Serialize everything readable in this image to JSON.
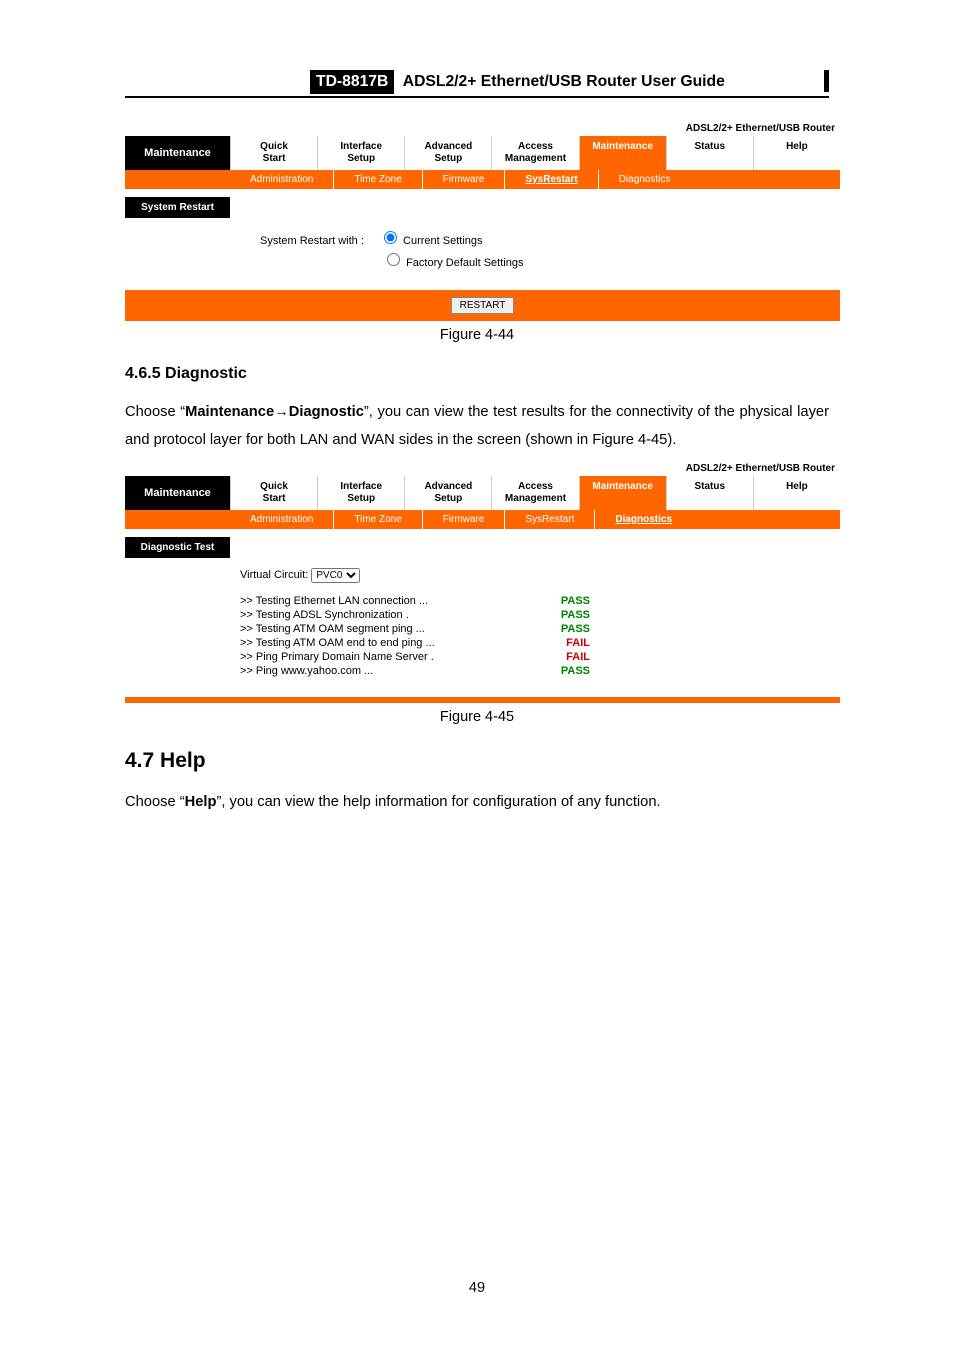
{
  "header": {
    "model": "TD-8817B",
    "title": "ADSL2/2+ Ethernet/USB Router User Guide"
  },
  "brand": "ADSL2/2+ Ethernet/USB Router",
  "top_tabs": [
    "Quick\nStart",
    "Interface\nSetup",
    "Advanced\nSetup",
    "Access\nManagement",
    "Maintenance",
    "Status",
    "Help"
  ],
  "sub_tabs_1": [
    "Administration",
    "Time Zone",
    "Firmware",
    "SysRestart",
    "Diagnostics"
  ],
  "maintenance_label": "Maintenance",
  "panel1": {
    "section": "System Restart",
    "active_sub": "SysRestart",
    "restart_label": "System Restart with :",
    "opts": [
      "Current Settings",
      "Factory Default Settings"
    ],
    "button": "RESTART",
    "caption": "Figure 4-44"
  },
  "sec465": {
    "num": "4.6.5  Diagnostic",
    "para1a": "Choose “",
    "bold1": "Maintenance→Diagnostic",
    "para1b": "”, you can view the test results for the connectivity of the physical layer and protocol layer for both LAN and WAN sides in the screen (shown in Figure 4-45)."
  },
  "panel2": {
    "section": "Diagnostic Test",
    "active_sub": "Diagnostics",
    "vc_label": "Virtual Circuit:",
    "vc_value": "PVC0",
    "rows": [
      {
        "t": ">> Testing Ethernet LAN connection ...",
        "s": "PASS"
      },
      {
        "t": ">> Testing ADSL Synchronization .",
        "s": "PASS"
      },
      {
        "t": ">> Testing ATM OAM segment ping ...",
        "s": "PASS"
      },
      {
        "t": ">> Testing ATM OAM end to end ping ...",
        "s": "FAIL"
      },
      {
        "t": ">> Ping Primary Domain Name Server .",
        "s": "FAIL"
      },
      {
        "t": ">> Ping www.yahoo.com ...",
        "s": "PASS"
      }
    ],
    "caption": "Figure 4-45"
  },
  "sec47": {
    "h": "4.7   Help",
    "para_a": "Choose “",
    "bold": "Help",
    "para_b": "”, you can view the help information for configuration of any function."
  },
  "page_number": "49"
}
